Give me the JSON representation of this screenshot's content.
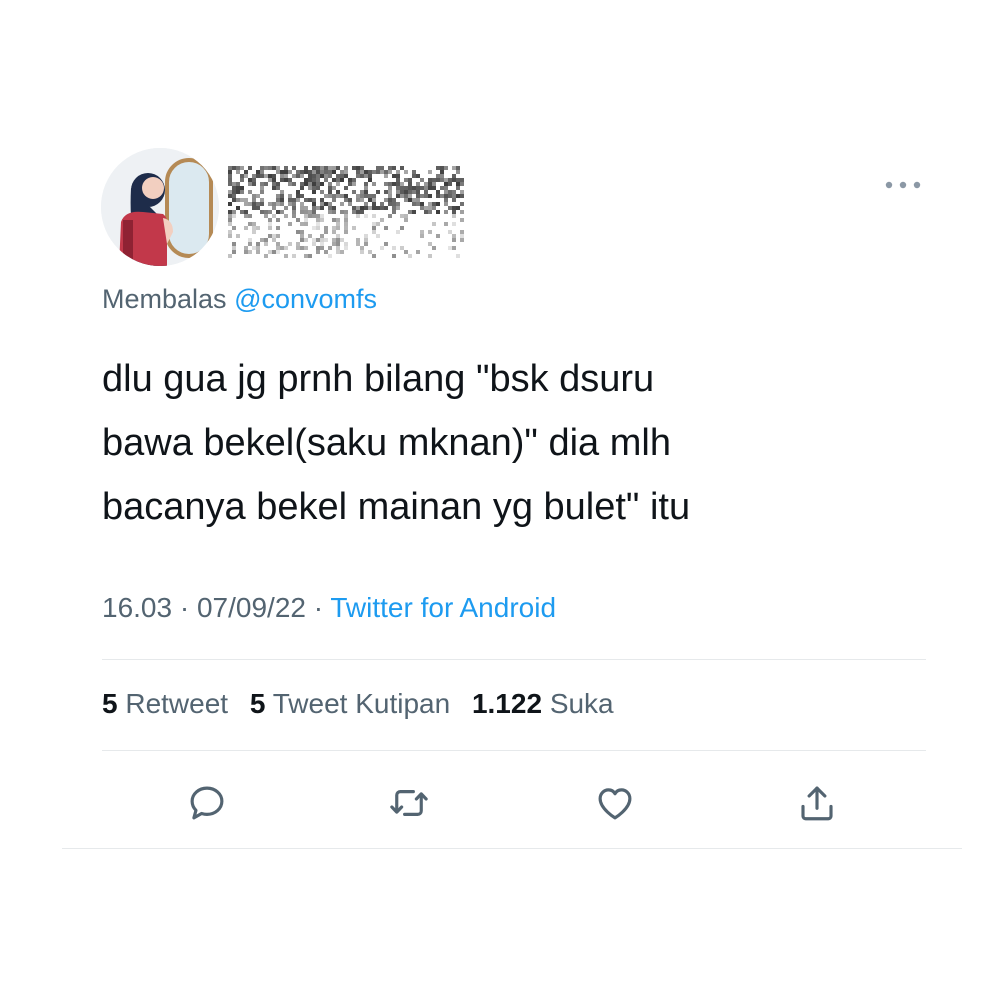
{
  "tweet": {
    "more_icon": "more-horizontal-icon",
    "reply_prefix": "Membalas",
    "reply_handle": "@convomfs",
    "text_lines": [
      "dlu gua jg prnh bilang \"bsk dsuru",
      "bawa bekel(saku mknan)\" dia mlh",
      "bacanya bekel mainan yg bulet\" itu"
    ],
    "time": "16.03",
    "separator": "·",
    "date": "07/09/22",
    "source": "Twitter for Android"
  },
  "stats": {
    "retweets_count": "5",
    "retweets_label": "Retweet",
    "quotes_count": "5",
    "quotes_label": "Tweet Kutipan",
    "likes_count": "1.122",
    "likes_label": "Suka"
  },
  "actions": [
    "reply-icon",
    "retweet-icon",
    "like-icon",
    "share-icon"
  ],
  "colors": {
    "text": "#0f1419",
    "secondary": "#536471",
    "accent": "#1d9bf0",
    "divider": "#e6e9eb"
  }
}
